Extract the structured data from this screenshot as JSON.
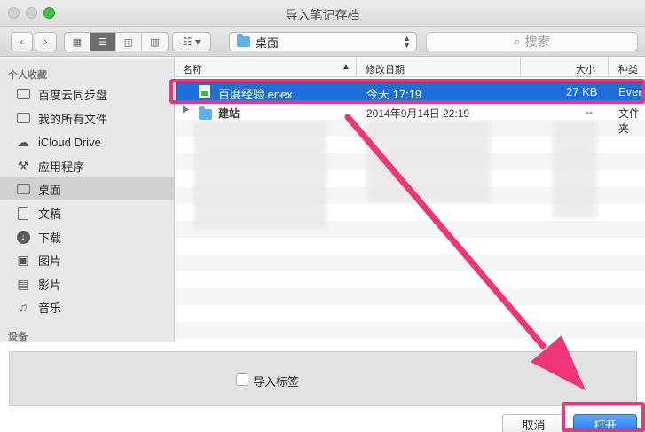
{
  "window": {
    "title": "导入笔记存档"
  },
  "toolbar": {
    "back_icon": "chevron-left-icon",
    "forward_icon": "chevron-right-icon",
    "view_modes": [
      "icon-view",
      "list-view",
      "column-view",
      "coverflow-view"
    ],
    "active_view": "list-view",
    "arrange_icon": "grid-arrange-icon",
    "location": "桌面",
    "search_placeholder": "搜索"
  },
  "sidebar": {
    "favorites_header": "个人收藏",
    "items": [
      {
        "label": "百度云同步盘",
        "icon": "folder-icon"
      },
      {
        "label": "我的所有文件",
        "icon": "all-files-icon"
      },
      {
        "label": "iCloud Drive",
        "icon": "cloud-icon"
      },
      {
        "label": "应用程序",
        "icon": "applications-icon"
      },
      {
        "label": "桌面",
        "icon": "desktop-icon",
        "selected": true
      },
      {
        "label": "文稿",
        "icon": "document-icon"
      },
      {
        "label": "下载",
        "icon": "download-icon"
      },
      {
        "label": "图片",
        "icon": "camera-icon"
      },
      {
        "label": "影片",
        "icon": "film-icon"
      },
      {
        "label": "音乐",
        "icon": "music-icon"
      }
    ],
    "devices_header": "设备"
  },
  "file_list": {
    "columns": {
      "name": "名称",
      "modified": "修改日期",
      "size": "大小",
      "kind": "种类"
    },
    "rows": [
      {
        "name": "百度经验.enex",
        "modified": "今天 17:19",
        "size": "27 KB",
        "kind": "Ever",
        "selected": true
      },
      {
        "name": "建站",
        "modified": "2014年9月14日 22:19",
        "size": "--",
        "kind": "文件夹",
        "selected": false
      }
    ]
  },
  "options": {
    "import_tags_label": "导入标签",
    "import_tags_checked": false
  },
  "buttons": {
    "cancel": "取消",
    "open": "打开"
  },
  "annotation_color": "#f0347a",
  "accent_color": "#1d6ed9"
}
